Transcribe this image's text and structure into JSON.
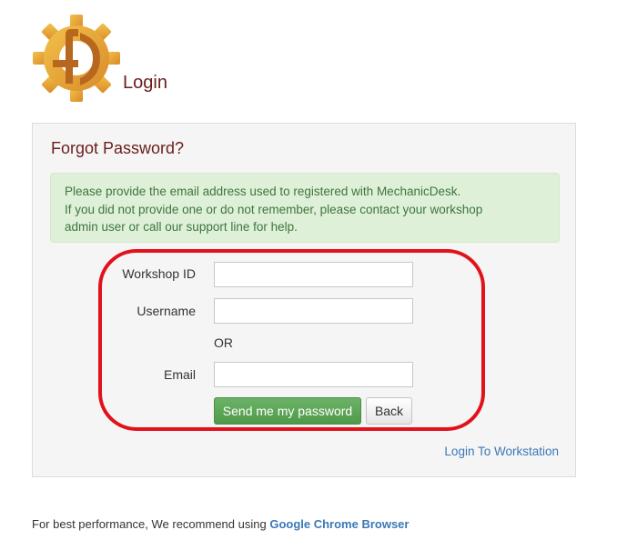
{
  "header": {
    "logo_icon": "gear-logo-icon",
    "title": "Login"
  },
  "form": {
    "title": "Forgot Password?",
    "info_lines": [
      "Please provide the email address used to registered with MechanicDesk.",
      "If you did not provide one or do not remember, please contact your workshop",
      "admin user or call our support line for help."
    ],
    "workshop_id_label": "Workshop ID",
    "workshop_id_value": "",
    "username_label": "Username",
    "username_value": "",
    "or_text": "OR",
    "email_label": "Email",
    "email_value": "",
    "send_button": "Send me my password",
    "back_button": "Back",
    "workstation_link": "Login To Workstation"
  },
  "footer": {
    "text": "For best performance, We recommend using ",
    "link": "Google Chrome Browser"
  },
  "colors": {
    "brand_title": "#6b1d1d",
    "info_bg": "#dff0d8",
    "info_text": "#3c763d",
    "primary_button": "#5ca657",
    "link": "#3a78b8",
    "annotation": "#e1121c",
    "logo_gold": "#e9a93a"
  }
}
